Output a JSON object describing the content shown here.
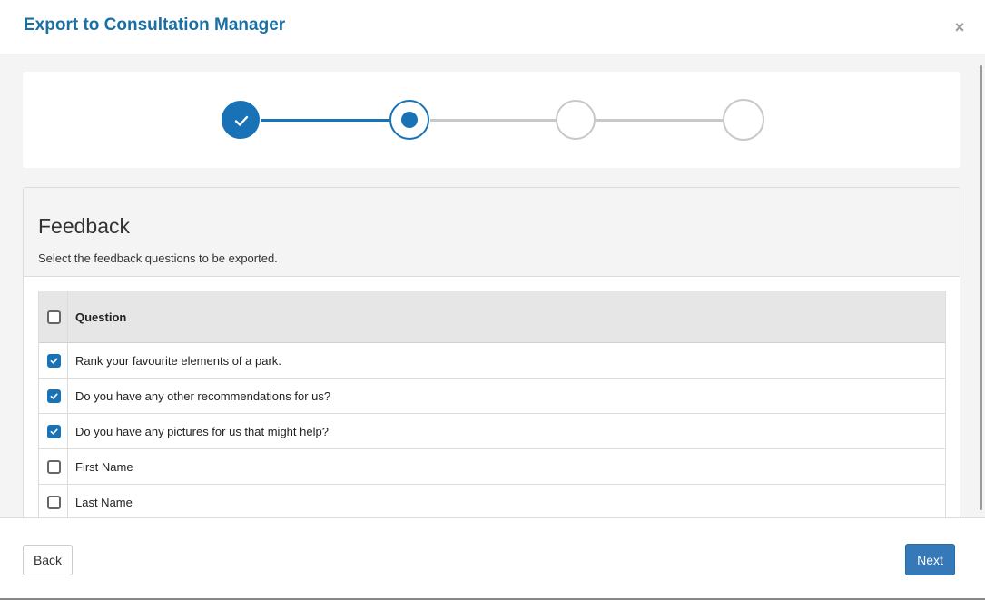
{
  "header": {
    "title": "Export to Consultation Manager",
    "close_symbol": "×"
  },
  "stepper": {
    "steps": [
      {
        "state": "completed"
      },
      {
        "state": "current"
      },
      {
        "state": "upcoming"
      },
      {
        "state": "upcoming"
      }
    ],
    "active_color": "#1a72b6",
    "inactive_color": "#c8c8c8"
  },
  "feedback": {
    "title": "Feedback",
    "subtitle": "Select the feedback questions to be exported.",
    "column_header": "Question",
    "select_all_checked": false,
    "questions": [
      {
        "label": "Rank your favourite elements of a park.",
        "checked": true
      },
      {
        "label": "Do you have any other recommendations for us?",
        "checked": true
      },
      {
        "label": "Do you have any pictures for us that might help?",
        "checked": true
      },
      {
        "label": "First Name",
        "checked": false
      },
      {
        "label": "Last Name",
        "checked": false
      }
    ]
  },
  "footer": {
    "back_label": "Back",
    "next_label": "Next"
  },
  "colors": {
    "title": "#1a6fa3",
    "primary_button": "#3579b8"
  }
}
